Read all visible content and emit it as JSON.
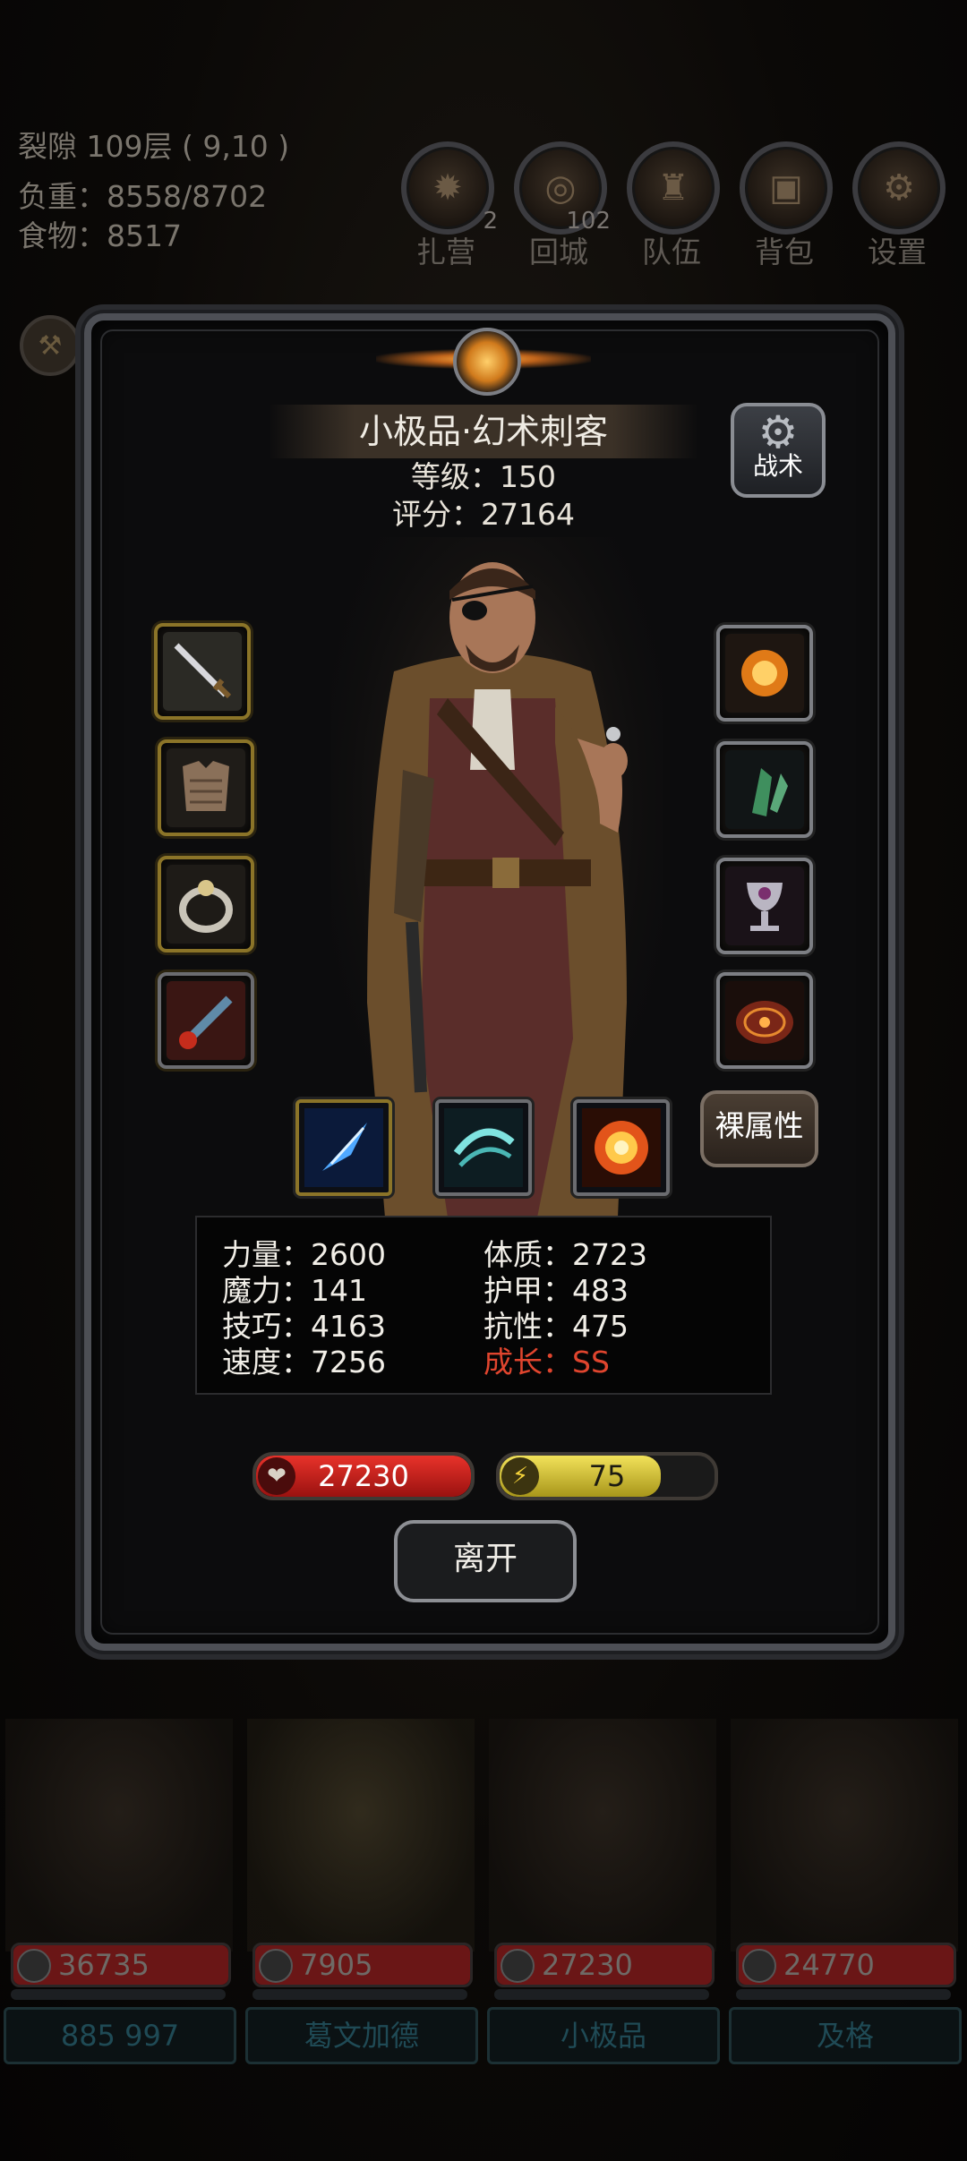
{
  "status": {
    "rift": "裂隙 109层 ( 9,10 )",
    "load": "负重：8558/8702",
    "food": "食物：8517"
  },
  "top_buttons": [
    {
      "label": "扎营",
      "badge": "2",
      "icon": "campfire-icon"
    },
    {
      "label": "回城",
      "badge": "102",
      "icon": "portal-icon"
    },
    {
      "label": "队伍",
      "badge": "",
      "icon": "team-icon"
    },
    {
      "label": "背包",
      "badge": "",
      "icon": "backpack-icon"
    },
    {
      "label": "设置",
      "badge": "",
      "icon": "gear-icon"
    }
  ],
  "hero": {
    "title": "小极品·幻术刺客",
    "level": "等级：150",
    "score": "评分：27164",
    "tactics_label": "战术",
    "base_attr_label": "裸属性",
    "leave_label": "离开"
  },
  "equipment_left": [
    "sword-icon",
    "armor-icon",
    "ring-icon",
    "wand-icon"
  ],
  "equipment_right": [
    "fire-orb-icon",
    "crystal-icon",
    "chalice-icon",
    "rune-disc-icon"
  ],
  "skills": [
    "ice-shard-skill-icon",
    "wind-slash-skill-icon",
    "explosion-skill-icon"
  ],
  "stats": {
    "strength": "力量：2600",
    "magic": "魔力：141",
    "skill": "技巧：4163",
    "speed": "速度：7256",
    "constitution": "体质：2723",
    "armor": "护甲：483",
    "resistance": "抗性：475",
    "growth": "成长：SS"
  },
  "hp_bar": {
    "value": "27230",
    "fill": 1.0
  },
  "energy_bar": {
    "value": "75",
    "fill": 0.75
  },
  "roster": [
    {
      "hp": "36735",
      "name": "885 997"
    },
    {
      "hp": "7905",
      "name": "葛文加德"
    },
    {
      "hp": "27230",
      "name": "小极品"
    },
    {
      "hp": "24770",
      "name": "及格"
    }
  ],
  "colors": {
    "growth": "#e0452e",
    "hp": "#c81a1a",
    "energy": "#d4c227"
  }
}
